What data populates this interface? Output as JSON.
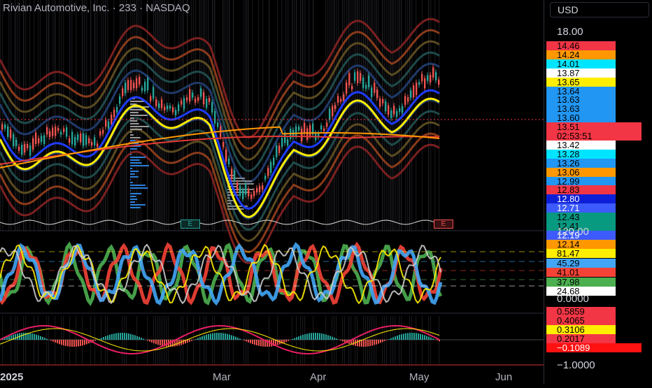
{
  "header": {
    "title": "Rivian Automotive, Inc. · 233 · NASDAQ"
  },
  "scale": {
    "currency": "USD",
    "main_ticks": [
      {
        "v": "18.00",
        "y": 45
      }
    ],
    "main_labels": [
      {
        "text": "14.46",
        "bg": "#f23645",
        "fg": "#000"
      },
      {
        "text": "14.24",
        "bg": "#ff9800",
        "fg": "#000"
      },
      {
        "text": "14.01",
        "bg": "#00e5ff",
        "fg": "#000"
      },
      {
        "text": "13.87",
        "bg": "#ffffff",
        "fg": "#000"
      },
      {
        "text": "13.65",
        "bg": "#ffee00",
        "fg": "#000"
      },
      {
        "text": "13.64",
        "bg": "#2196f3",
        "fg": "#000"
      },
      {
        "text": "13.63",
        "bg": "#2196f3",
        "fg": "#000"
      },
      {
        "text": "13.63",
        "bg": "#2196f3",
        "fg": "#000"
      },
      {
        "text": "13.60",
        "bg": "#2196f3",
        "fg": "#000"
      },
      {
        "text": "13.51",
        "bg": "#f23645",
        "fg": "#000"
      },
      {
        "text": "02:53:51",
        "bg": "#f23645",
        "fg": "#000"
      },
      {
        "text": "13.42",
        "bg": "#ffffff",
        "fg": "#000"
      },
      {
        "text": "13.28",
        "bg": "#00e5ff",
        "fg": "#000"
      },
      {
        "text": "13.26",
        "bg": "#2196f3",
        "fg": "#000"
      },
      {
        "text": "13.06",
        "bg": "#ff9800",
        "fg": "#000"
      },
      {
        "text": "12.99",
        "bg": "#2196f3",
        "fg": "#000"
      },
      {
        "text": "12.83",
        "bg": "#f23645",
        "fg": "#000"
      },
      {
        "text": "12.80",
        "bg": "#0d1fd6",
        "fg": "#fff"
      },
      {
        "text": "12.71",
        "bg": "#3d5afe",
        "fg": "#fff"
      },
      {
        "text": "12.43",
        "bg": "#089981",
        "fg": "#000"
      },
      {
        "text": "12.41",
        "bg": "#089981",
        "fg": "#000"
      },
      {
        "text": "12.19",
        "bg": "#3d5afe",
        "fg": "#fff"
      },
      {
        "text": "12.14",
        "bg": "#ff9800",
        "fg": "#000"
      }
    ],
    "osc_ticks": [
      "120.00",
      "0.0000"
    ],
    "osc_labels": [
      {
        "text": "81.47",
        "bg": "#ffee00",
        "fg": "#000"
      },
      {
        "text": "45.29",
        "bg": "#42a5f5",
        "fg": "#000"
      },
      {
        "text": "41.01",
        "bg": "#f44336",
        "fg": "#000"
      },
      {
        "text": "37.98",
        "bg": "#4caf50",
        "fg": "#000"
      },
      {
        "text": "24.68",
        "bg": "#ffffff",
        "fg": "#000"
      }
    ],
    "macd_labels": [
      {
        "text": "0.5859",
        "bg": "#f23645",
        "fg": "#000"
      },
      {
        "text": "0.4065",
        "bg": "#f23645",
        "fg": "#000"
      },
      {
        "text": "0.3106",
        "bg": "#ffee00",
        "fg": "#000"
      },
      {
        "text": "0.2017",
        "bg": "#f23645",
        "fg": "#000"
      },
      {
        "text": "−0.1089",
        "bg": "#ff1111",
        "fg": "#fff"
      }
    ],
    "macd_tick": "−1.0000"
  },
  "time_axis": [
    "2025",
    "Mar",
    "Apr",
    "May",
    "Jun"
  ],
  "earnings_marker": "E",
  "colors": {
    "up": "#26a69a",
    "down": "#ef5350",
    "ma_blue": "#1e3cff",
    "ma_yellow": "#ffee00",
    "ma_orange": "#ff9800",
    "ma_red": "#e53935"
  }
}
